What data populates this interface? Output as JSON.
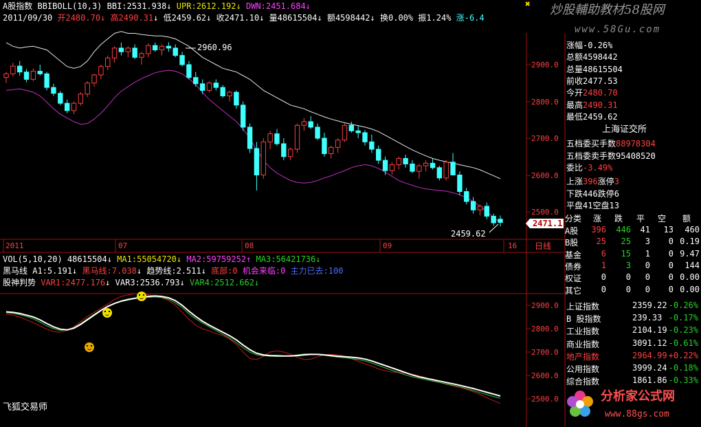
{
  "watermark": {
    "cn": "炒股輔助教材58股网",
    "url": "www.58Gu.com",
    "bottom_cn": "分析家公式网",
    "bottom_url": "www.88gs.com"
  },
  "header": {
    "index_name": "A股指数",
    "boll": "BBIBOLL(10,3)",
    "bbi": "BBI:2531.938",
    "upr": "UPR:2612.192",
    "dwn": "DWN:2451.684",
    "date": "2011/09/30",
    "open": "开2480.70",
    "high": "高2490.31",
    "low": "低2459.62",
    "close": "收2471.10",
    "vol": "量48615504",
    "amount": "额4598442",
    "turnover": "换0.00%",
    "amplitude": "振1.24%",
    "change": "涨-6.4"
  },
  "price_axis": {
    "labels": [
      "2900.0",
      "2800.0",
      "2700.0",
      "2600.0",
      "2500.0"
    ],
    "current": "2471.1"
  },
  "annotations": {
    "high_mark": "2960.96",
    "low_mark": "2459.62"
  },
  "date_axis": {
    "labels": [
      "2011",
      "07",
      "08",
      "09",
      "16"
    ],
    "period": "日线"
  },
  "volume_bar": {
    "label": "VOL(5,10,20)",
    "value": "48615504",
    "ma1": "MA1:55054720",
    "ma2": "MA2:59759252",
    "ma3": "MA3:56421736"
  },
  "heima": {
    "title": "黑马线",
    "a1": "A1:5.191",
    "heima": "黑马线:7.038",
    "trend": "趋势线:2.511",
    "bottom": "底部:0",
    "chance": "机会来临:0",
    "gone": "主力已去:100"
  },
  "gushen": {
    "title": "股神判势",
    "var1": "VAR1:2477.176",
    "var2": "VAR3:2536.793",
    "var4": "VAR4:2512.662"
  },
  "lower_axis": {
    "labels": [
      "2900.0",
      "2800.0",
      "2700.0",
      "2600.0",
      "2500.0"
    ]
  },
  "footer": {
    "title": "飞狐交易师"
  },
  "right_panel": {
    "stats": [
      {
        "k": "涨幅",
        "v": "-0.26%",
        "c": "#ffffff"
      },
      {
        "k": "总额",
        "v": "4598442",
        "c": "#ffffff"
      },
      {
        "k": "总量",
        "v": "48615504",
        "c": "#ffffff"
      },
      {
        "k": "前收",
        "v": "2477.53",
        "c": "#ffffff"
      },
      {
        "k": "今开",
        "v": "2480.70",
        "c": "#ff4040"
      },
      {
        "k": "最高",
        "v": "2490.31",
        "c": "#ff4040"
      },
      {
        "k": "最低",
        "v": "2459.62",
        "c": "#ffffff"
      }
    ],
    "exchange": "上海证交所",
    "orders": [
      {
        "k": "五档委买手数",
        "v": "88978304",
        "c": "#ff4040"
      },
      {
        "k": "五档委卖手数",
        "v": "95408520",
        "c": "#ffffff"
      },
      {
        "k": "委比",
        "v": "-3.49%",
        "c": "#ff4040"
      }
    ],
    "breadth": [
      {
        "k1": "上涨",
        "v1": "396",
        "k2": "涨停",
        "v2": "3"
      },
      {
        "k1": "下跌",
        "v1": "446",
        "k2": "跌停",
        "v2": "6"
      },
      {
        "k1": "平盘",
        "v1": "41",
        "k2": "空盘",
        "v2": "13"
      }
    ],
    "table_header": [
      "分类",
      "涨",
      "跌",
      "平",
      "空",
      "额"
    ],
    "table_rows": [
      [
        "A股",
        "396",
        "446",
        "41",
        "13",
        "460"
      ],
      [
        "B股",
        "25",
        "25",
        "3",
        "0",
        "0.19"
      ],
      [
        "基金",
        "6",
        "15",
        "1",
        "0",
        "9.47"
      ],
      [
        "债券",
        "1",
        "3",
        "0",
        "0",
        "144"
      ],
      [
        "权证",
        "0",
        "0",
        "0",
        "0",
        "0.00"
      ],
      [
        "其它",
        "0",
        "0",
        "0",
        "0",
        "0.00"
      ]
    ],
    "indices": [
      {
        "k": "上证指数",
        "v": "2359.22",
        "p": "-0.26%"
      },
      {
        "k": "B 股指数",
        "v": "239.33",
        "p": "-0.17%"
      },
      {
        "k": "工业指数",
        "v": "2104.19",
        "p": "-0.23%"
      },
      {
        "k": "商业指数",
        "v": "3091.12",
        "p": "-0.61%"
      },
      {
        "k": "地产指数",
        "v": "2964.99",
        "p": "+0.22%"
      },
      {
        "k": "公用指数",
        "v": "3999.24",
        "p": "-0.18%"
      },
      {
        "k": "综合指数",
        "v": "1861.86",
        "p": "-0.33%"
      }
    ]
  },
  "chart_data": {
    "type": "line",
    "candles": [
      [
        2865,
        2880,
        2850,
        2875
      ],
      [
        2875,
        2905,
        2868,
        2896
      ],
      [
        2896,
        2910,
        2870,
        2880
      ],
      [
        2880,
        2888,
        2852,
        2860
      ],
      [
        2860,
        2890,
        2855,
        2882
      ],
      [
        2882,
        2900,
        2870,
        2875
      ],
      [
        2875,
        2880,
        2830,
        2838
      ],
      [
        2838,
        2848,
        2815,
        2822
      ],
      [
        2822,
        2828,
        2790,
        2795
      ],
      [
        2795,
        2805,
        2768,
        2775
      ],
      [
        2775,
        2800,
        2765,
        2795
      ],
      [
        2795,
        2825,
        2788,
        2820
      ],
      [
        2820,
        2855,
        2812,
        2850
      ],
      [
        2850,
        2875,
        2840,
        2872
      ],
      [
        2872,
        2900,
        2860,
        2895
      ],
      [
        2895,
        2925,
        2885,
        2918
      ],
      [
        2918,
        2950,
        2905,
        2945
      ],
      [
        2945,
        2960,
        2925,
        2935
      ],
      [
        2935,
        2950,
        2920,
        2945
      ],
      [
        2945,
        2955,
        2915,
        2920
      ],
      [
        2920,
        2935,
        2900,
        2930
      ],
      [
        2930,
        2958,
        2920,
        2952
      ],
      [
        2952,
        2960,
        2935,
        2940
      ],
      [
        2940,
        2955,
        2925,
        2950
      ],
      [
        2950,
        2961,
        2935,
        2945
      ],
      [
        2945,
        2955,
        2920,
        2925
      ],
      [
        2925,
        2935,
        2895,
        2900
      ],
      [
        2900,
        2910,
        2860,
        2865
      ],
      [
        2865,
        2880,
        2840,
        2848
      ],
      [
        2848,
        2860,
        2820,
        2830
      ],
      [
        2830,
        2855,
        2825,
        2850
      ],
      [
        2850,
        2860,
        2830,
        2838
      ],
      [
        2838,
        2845,
        2810,
        2815
      ],
      [
        2815,
        2830,
        2800,
        2825
      ],
      [
        2825,
        2830,
        2780,
        2790
      ],
      [
        2790,
        2800,
        2720,
        2730
      ],
      [
        2730,
        2740,
        2660,
        2672
      ],
      [
        2672,
        2690,
        2558,
        2600
      ],
      [
        2600,
        2700,
        2590,
        2690
      ],
      [
        2690,
        2720,
        2670,
        2712
      ],
      [
        2712,
        2725,
        2680,
        2685
      ],
      [
        2685,
        2700,
        2640,
        2650
      ],
      [
        2650,
        2675,
        2640,
        2670
      ],
      [
        2670,
        2740,
        2660,
        2735
      ],
      [
        2735,
        2755,
        2720,
        2745
      ],
      [
        2745,
        2760,
        2725,
        2730
      ],
      [
        2730,
        2740,
        2695,
        2700
      ],
      [
        2700,
        2715,
        2650,
        2658
      ],
      [
        2658,
        2680,
        2645,
        2675
      ],
      [
        2675,
        2700,
        2660,
        2695
      ],
      [
        2695,
        2740,
        2690,
        2735
      ],
      [
        2735,
        2745,
        2715,
        2720
      ],
      [
        2720,
        2735,
        2700,
        2715
      ],
      [
        2715,
        2722,
        2680,
        2690
      ],
      [
        2690,
        2710,
        2660,
        2670
      ],
      [
        2670,
        2680,
        2630,
        2640
      ],
      [
        2640,
        2650,
        2600,
        2612
      ],
      [
        2612,
        2635,
        2600,
        2628
      ],
      [
        2628,
        2650,
        2615,
        2645
      ],
      [
        2645,
        2655,
        2620,
        2630
      ],
      [
        2630,
        2640,
        2605,
        2610
      ],
      [
        2610,
        2630,
        2590,
        2625
      ],
      [
        2625,
        2640,
        2610,
        2632
      ],
      [
        2632,
        2645,
        2615,
        2620
      ],
      [
        2620,
        2625,
        2585,
        2592
      ],
      [
        2592,
        2640,
        2585,
        2635
      ],
      [
        2635,
        2660,
        2625,
        2600
      ],
      [
        2600,
        2610,
        2545,
        2555
      ],
      [
        2555,
        2565,
        2520,
        2528
      ],
      [
        2528,
        2540,
        2495,
        2505
      ],
      [
        2505,
        2520,
        2490,
        2515
      ],
      [
        2515,
        2525,
        2480,
        2488
      ],
      [
        2488,
        2495,
        2462,
        2470
      ],
      [
        2480,
        2490,
        2460,
        2471
      ]
    ],
    "upr": [
      2960,
      2950,
      2945,
      2948,
      2950,
      2945,
      2940,
      2925,
      2910,
      2895,
      2890,
      2895,
      2910,
      2935,
      2955,
      2970,
      2985,
      2990,
      2985,
      2985,
      2982,
      2980,
      2978,
      2978,
      2975,
      2970,
      2960,
      2950,
      2935,
      2920,
      2910,
      2900,
      2890,
      2885,
      2880,
      2870,
      2860,
      2845,
      2830,
      2820,
      2810,
      2800,
      2790,
      2785,
      2780,
      2772,
      2765,
      2758,
      2752,
      2747,
      2742,
      2738,
      2734,
      2730,
      2725,
      2718,
      2708,
      2698,
      2688,
      2678,
      2668,
      2660,
      2652,
      2645,
      2640,
      2636,
      2632,
      2628,
      2624,
      2620,
      2614,
      2606,
      2598,
      2590
    ],
    "bbi": [
      2870,
      2872,
      2874,
      2873,
      2872,
      2868,
      2860,
      2850,
      2838,
      2825,
      2815,
      2812,
      2815,
      2825,
      2840,
      2858,
      2878,
      2895,
      2905,
      2915,
      2922,
      2928,
      2935,
      2938,
      2940,
      2938,
      2932,
      2922,
      2908,
      2895,
      2882,
      2870,
      2858,
      2845,
      2832,
      2815,
      2795,
      2770,
      2750,
      2740,
      2730,
      2720,
      2712,
      2706,
      2702,
      2700,
      2698,
      2695,
      2692,
      2690,
      2692,
      2696,
      2700,
      2702,
      2700,
      2695,
      2685,
      2672,
      2660,
      2650,
      2642,
      2636,
      2632,
      2630,
      2628,
      2625,
      2620,
      2612,
      2600,
      2585,
      2568,
      2550,
      2535,
      2525
    ],
    "dwn": [
      2830,
      2832,
      2834,
      2830,
      2825,
      2815,
      2798,
      2780,
      2765,
      2755,
      2745,
      2738,
      2740,
      2752,
      2768,
      2788,
      2810,
      2828,
      2840,
      2852,
      2862,
      2870,
      2878,
      2882,
      2885,
      2882,
      2875,
      2862,
      2845,
      2825,
      2805,
      2790,
      2775,
      2760,
      2745,
      2725,
      2700,
      2668,
      2640,
      2620,
      2605,
      2595,
      2585,
      2580,
      2578,
      2580,
      2585,
      2592,
      2598,
      2605,
      2612,
      2620,
      2625,
      2628,
      2625,
      2618,
      2608,
      2596,
      2585,
      2578,
      2572,
      2566,
      2562,
      2560,
      2558,
      2556,
      2552,
      2546,
      2538,
      2528,
      2515,
      2500,
      2485,
      2470
    ],
    "white": [
      2872,
      2870,
      2865,
      2858,
      2850,
      2838,
      2822,
      2808,
      2798,
      2795,
      2802,
      2818,
      2838,
      2858,
      2878,
      2895,
      2908,
      2918,
      2925,
      2930,
      2935,
      2938,
      2940,
      2938,
      2932,
      2920,
      2900,
      2875,
      2852,
      2832,
      2815,
      2800,
      2785,
      2770,
      2752,
      2730,
      2710,
      2695,
      2688,
      2685,
      2684,
      2683,
      2683,
      2685,
      2688,
      2690,
      2690,
      2688,
      2685,
      2682,
      2680,
      2678,
      2675,
      2670,
      2662,
      2652,
      2642,
      2632,
      2622,
      2612,
      2602,
      2594,
      2588,
      2582,
      2576,
      2570,
      2564,
      2558,
      2551,
      2544,
      2536,
      2528,
      2520,
      2512
    ],
    "green": [
      2868,
      2866,
      2860,
      2852,
      2842,
      2828,
      2812,
      2800,
      2793,
      2795,
      2805,
      2822,
      2842,
      2862,
      2880,
      2896,
      2908,
      2916,
      2922,
      2928,
      2932,
      2934,
      2936,
      2933,
      2926,
      2910,
      2890,
      2864,
      2842,
      2824,
      2808,
      2792,
      2776,
      2760,
      2740,
      2718,
      2700,
      2688,
      2684,
      2682,
      2681,
      2682,
      2684,
      2688,
      2692,
      2692,
      2690,
      2686,
      2682,
      2678,
      2676,
      2672,
      2668,
      2662,
      2653,
      2643,
      2632,
      2622,
      2612,
      2602,
      2594,
      2588,
      2582,
      2576,
      2570,
      2564,
      2558,
      2552,
      2544,
      2535,
      2526,
      2518,
      2510,
      2502
    ],
    "red": [
      2862,
      2858,
      2850,
      2838,
      2826,
      2812,
      2798,
      2788,
      2785,
      2792,
      2808,
      2830,
      2852,
      2870,
      2888,
      2905,
      2925,
      2938,
      2945,
      2950,
      2948,
      2945,
      2940,
      2932,
      2920,
      2900,
      2870,
      2840,
      2815,
      2800,
      2790,
      2780,
      2770,
      2755,
      2732,
      2700,
      2672,
      2668,
      2682,
      2700,
      2705,
      2700,
      2690,
      2678,
      2668,
      2670,
      2680,
      2688,
      2690,
      2688,
      2682,
      2672,
      2660,
      2650,
      2640,
      2628,
      2620,
      2615,
      2612,
      2610,
      2605,
      2598,
      2590,
      2580,
      2570,
      2562,
      2555,
      2548,
      2540,
      2530,
      2518,
      2505,
      2492,
      2480
    ]
  }
}
